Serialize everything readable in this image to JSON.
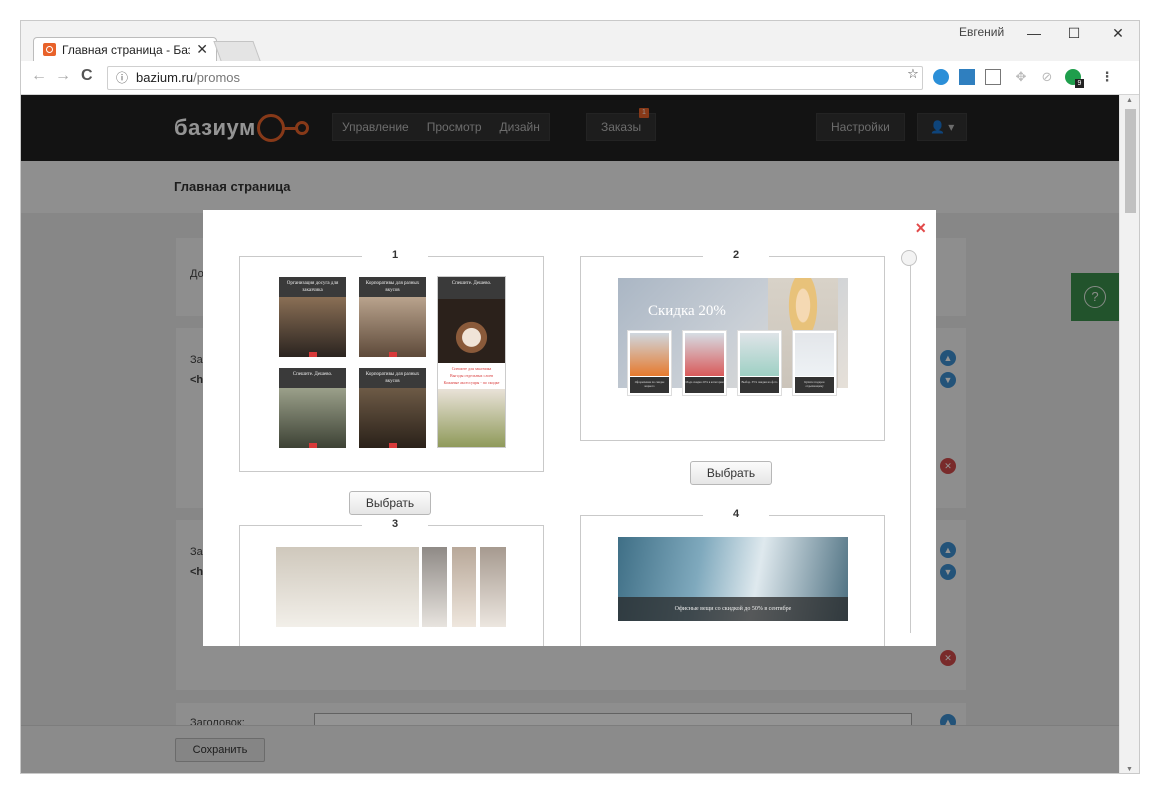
{
  "browser": {
    "tab_title": "Главная страница - Базиум",
    "tab_close": "✕",
    "user_name": "Евгений",
    "min_glyph": "—",
    "max_glyph": "☐",
    "close_glyph": "✕",
    "back_glyph": "←",
    "forward_glyph": "→",
    "reload_glyph": "C",
    "url_host": "bazium.ru",
    "url_path": "/promos",
    "info_glyph": "ⓘ",
    "star_glyph": "☆",
    "menu_glyph": "⋮",
    "extension_badge": "9"
  },
  "header": {
    "logo": "базиум",
    "nav": [
      "Управление",
      "Просмотр",
      "Дизайн"
    ],
    "orders": "Заказы",
    "orders_badge": "1",
    "settings": "Настройки",
    "user_icon": "👤 ▾"
  },
  "page": {
    "title": "Главная страница",
    "field_label_1": "До",
    "field_label_2": "За",
    "field_label_3": "<h",
    "field_label_4": "За",
    "field_label_5": "<h",
    "heading_label": "Заголовок:",
    "save_button": "Сохранить",
    "help_glyph": "?"
  },
  "modal": {
    "close_glyph": "×",
    "choose_label": "Выбрать",
    "templates": [
      {
        "number": "1",
        "captions": [
          "Организация досуга для заказчика",
          "Корпоративы для разных вкусов",
          "Спешите. Дешево.",
          "Спешите. Дешево.",
          "Корпоративы для разных вкусов"
        ],
        "popup_lines": [
          "Спешите для заказчика",
          "Выгоды отдельных слоев",
          "Кожаные аксессуары - по скидке"
        ]
      },
      {
        "number": "2",
        "headline": "Скидка 20%",
        "mini_captions": [
          "Оформление по скидке жаркого",
          "Мода скидка 20% в категории",
          "Выбор. 35% скидки на фото",
          "Купите подарок отдыхающему"
        ]
      },
      {
        "number": "3"
      },
      {
        "number": "4",
        "caption": "Офисные вещи со скидкой до 50% в сентябре"
      }
    ]
  }
}
